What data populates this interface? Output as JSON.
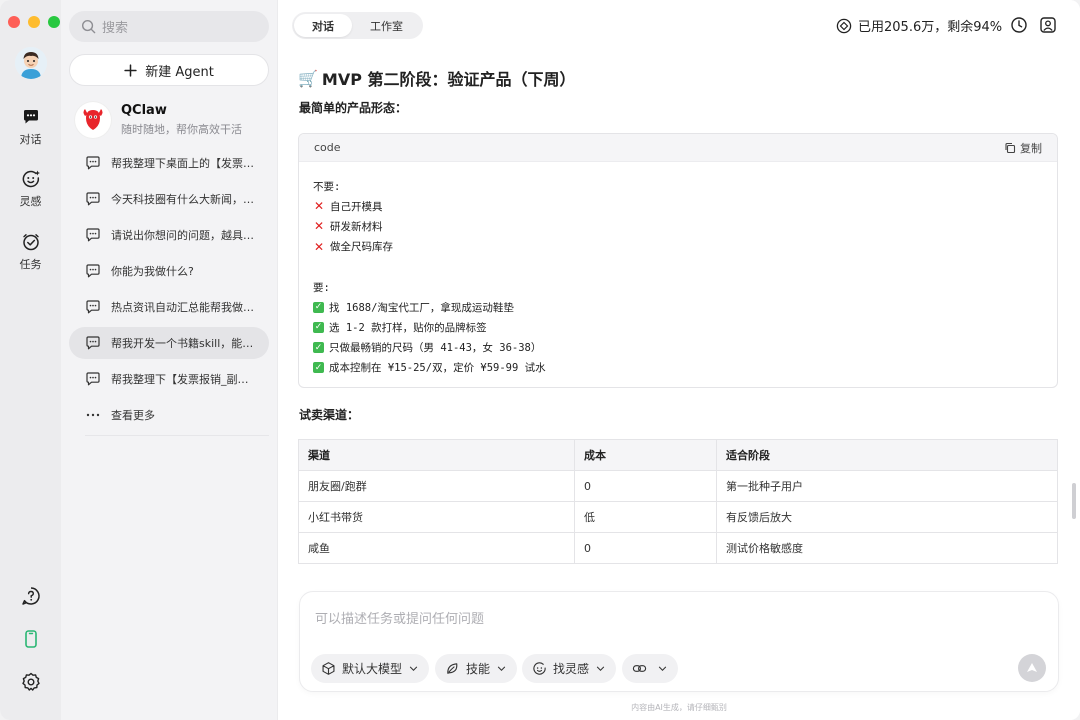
{
  "rail": {
    "items": [
      {
        "label": "对话",
        "icon": "chat-bubble-icon"
      },
      {
        "label": "灵感",
        "icon": "smile-sparkle-icon"
      },
      {
        "label": "任务",
        "icon": "check-circle-icon"
      }
    ],
    "bottom_icons": [
      "help-icon",
      "phone-icon",
      "gear-icon"
    ]
  },
  "sidebar": {
    "search_placeholder": "搜索",
    "new_agent_label": "新建 Agent",
    "agent": {
      "name": "QClaw",
      "subtitle": "随时随地，帮你高效干活"
    },
    "chats": [
      "帮我整理下桌面上的【发票报销】文件夹",
      "今天科技圈有什么大新闻，帮我总结一下",
      "请说出你想问的问题，越具体越好",
      "你能为我做什么?",
      "热点资讯自动汇总能帮我做什么",
      "帮我开发一个书籍skill，能够自动整理",
      "帮我整理下【发票报销_副本】文件夹"
    ],
    "active_chat_index": 5,
    "more_label": "查看更多"
  },
  "header": {
    "tabs": [
      "对话",
      "工作室"
    ],
    "active_tab": 0,
    "usage_text": "已用205.6万，剩余94%"
  },
  "content": {
    "heading": "MVP 第二阶段：验证产品（下周）",
    "heading_emoji": "🛒",
    "form_label": "最简单的产品形态：",
    "code": {
      "lang": "code",
      "copy_label": "复制",
      "lines": [
        {
          "mark": "",
          "text": "不要:"
        },
        {
          "mark": "x",
          "text": "自己开模具"
        },
        {
          "mark": "x",
          "text": "研发新材料"
        },
        {
          "mark": "x",
          "text": "做全尺码库存"
        },
        {
          "mark": "",
          "text": ""
        },
        {
          "mark": "",
          "text": "要:"
        },
        {
          "mark": "ok",
          "text": "找 1688/淘宝代工厂，拿现成运动鞋垫"
        },
        {
          "mark": "ok",
          "text": "选 1-2 款打样，贴你的品牌标签"
        },
        {
          "mark": "ok",
          "text": "只做最畅销的尺码（男 41-43，女 36-38）"
        },
        {
          "mark": "ok",
          "text": "成本控制在 ¥15-25/双，定价 ¥59-99 试水"
        }
      ]
    },
    "channels_label": "试卖渠道：",
    "table": {
      "headers": [
        "渠道",
        "成本",
        "适合阶段"
      ],
      "rows": [
        [
          "朋友圈/跑群",
          "0",
          "第一批种子用户"
        ],
        [
          "小红书带货",
          "低",
          "有反馈后放大"
        ],
        [
          "咸鱼",
          "0",
          "测试价格敏感度"
        ]
      ]
    }
  },
  "composer": {
    "placeholder": "可以描述任务或提问任何问题",
    "chips": {
      "model": "默认大模型",
      "skills": "技能",
      "inspiration": "找灵感"
    },
    "footer_note": "内容由AI生成，请仔细甄别"
  }
}
